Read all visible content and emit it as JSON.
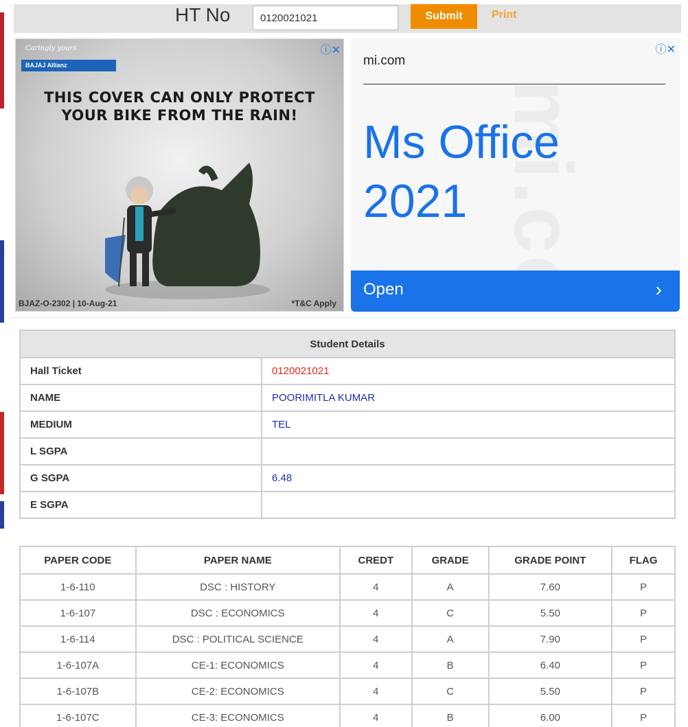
{
  "search": {
    "label": "HT No",
    "value": "0120021021",
    "submit_label": "Submit",
    "print_label": "Print"
  },
  "ad_left": {
    "tagline": "Caringly yours",
    "brand": "BAJAJ Allianz",
    "headline_line1": "THIS COVER CAN ONLY PROTECT",
    "headline_line2": "YOUR BIKE FROM THE RAIN!",
    "footer_left": "BJAZ-O-2302 | 10-Aug-21",
    "footer_right": "*T&C Apply"
  },
  "ad_right": {
    "domain": "mi.com",
    "title_line1": "Ms Office",
    "title_line2": "2021",
    "open_label": "Open",
    "watermark": "mi.com"
  },
  "student": {
    "header": "Student Details",
    "rows": [
      {
        "label": "Hall Ticket",
        "value": "0120021021"
      },
      {
        "label": "NAME",
        "value": "POORIMITLA KUMAR"
      },
      {
        "label": "MEDIUM",
        "value": "TEL"
      },
      {
        "label": "L SGPA",
        "value": ""
      },
      {
        "label": "G SGPA",
        "value": "6.48"
      },
      {
        "label": "E SGPA",
        "value": ""
      }
    ]
  },
  "marks": {
    "headers": [
      "PAPER CODE",
      "PAPER NAME",
      "CREDT",
      "GRADE",
      "GRADE POINT",
      "FLAG"
    ],
    "rows": [
      [
        "1-6-110",
        "DSC : HISTORY",
        "4",
        "A",
        "7.60",
        "P"
      ],
      [
        "1-6-107",
        "DSC : ECONOMICS",
        "4",
        "C",
        "5.50",
        "P"
      ],
      [
        "1-6-114",
        "DSC : POLITICAL SCIENCE",
        "4",
        "A",
        "7.90",
        "P"
      ],
      [
        "1-6-107A",
        "CE-1: ECONOMICS",
        "4",
        "B",
        "6.40",
        "P"
      ],
      [
        "1-6-107B",
        "CE-2: ECONOMICS",
        "4",
        "C",
        "5.50",
        "P"
      ],
      [
        "1-6-107C",
        "CE-3: ECONOMICS",
        "4",
        "B",
        "6.00",
        "P"
      ]
    ]
  },
  "colors": {
    "accent": "#f08c00",
    "ad_blue": "#1a73e8",
    "value_blue": "#1e2fae",
    "value_red": "#e0281c"
  },
  "icons": [
    "info-icon",
    "close-icon",
    "chevron-right-icon"
  ]
}
